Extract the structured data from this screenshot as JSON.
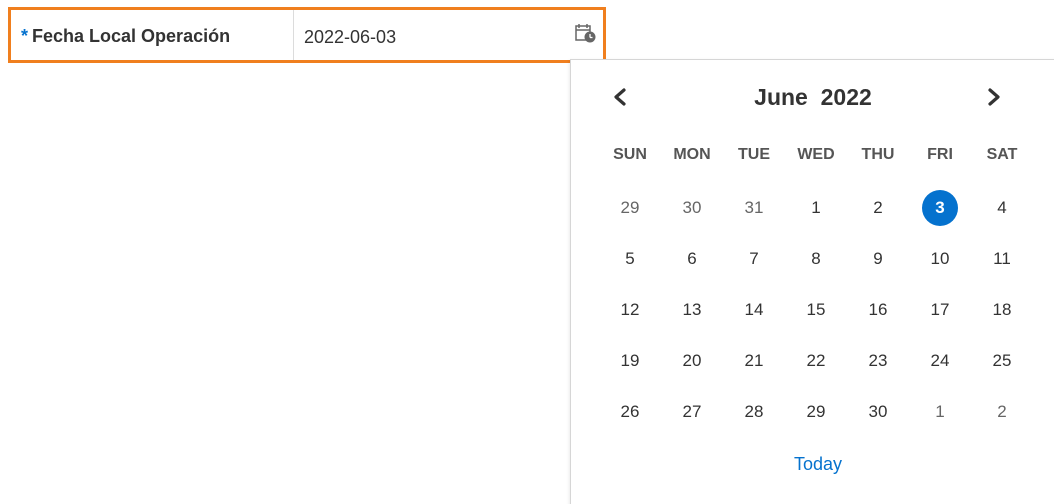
{
  "field": {
    "required_marker": "*",
    "label": "Fecha Local Operación",
    "value": "2022-06-03",
    "icon": "calendar-icon"
  },
  "calendar": {
    "month": "June",
    "year": "2022",
    "prev_icon": "chevron-left-icon",
    "next_icon": "chevron-right-icon",
    "weekdays": [
      "SUN",
      "MON",
      "TUE",
      "WED",
      "THU",
      "FRI",
      "SAT"
    ],
    "weeks": [
      [
        "29",
        "30",
        "31",
        "1",
        "2",
        "3",
        "4"
      ],
      [
        "5",
        "6",
        "7",
        "8",
        "9",
        "10",
        "11"
      ],
      [
        "12",
        "13",
        "14",
        "15",
        "16",
        "17",
        "18"
      ],
      [
        "19",
        "20",
        "21",
        "22",
        "23",
        "24",
        "25"
      ],
      [
        "26",
        "27",
        "28",
        "29",
        "30",
        "1",
        "2"
      ]
    ],
    "selected_day": "3",
    "today_label": "Today"
  },
  "colors": {
    "highlight": "#f07f1e",
    "accent": "#0572ce"
  }
}
